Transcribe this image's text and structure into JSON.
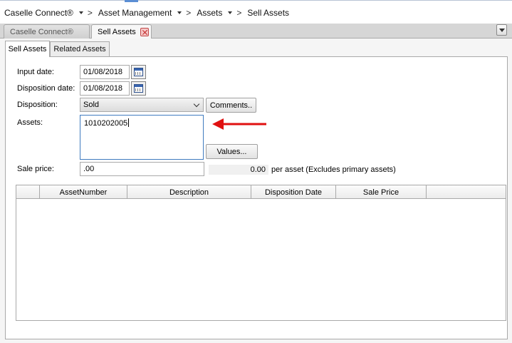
{
  "breadcrumb": {
    "items": [
      "Caselle Connect®",
      "Asset Management",
      "Assets",
      "Sell Assets"
    ],
    "separator": ">"
  },
  "doc_tabs": [
    {
      "label": "Caselle Connect®",
      "active": false
    },
    {
      "label": "Sell Assets",
      "active": true
    }
  ],
  "sub_tabs": [
    {
      "label": "Sell Assets",
      "active": true
    },
    {
      "label": "Related Assets",
      "active": false
    }
  ],
  "form": {
    "input_date_label": "Input date:",
    "input_date_value": "01/08/2018",
    "disposition_date_label": "Disposition date:",
    "disposition_date_value": "01/08/2018",
    "disposition_label": "Disposition:",
    "disposition_value": "Sold",
    "comments_button": "Comments..",
    "assets_label": "Assets:",
    "assets_value": "1010202005",
    "values_button": "Values...",
    "sale_price_label": "Sale price:",
    "sale_price_value": ".00",
    "per_asset_value": "0.00",
    "per_asset_note": "per asset (Excludes primary assets)"
  },
  "grid": {
    "columns": [
      "AssetNumber",
      "Description",
      "Disposition Date",
      "Sale Price"
    ],
    "rows": []
  },
  "colors": {
    "annotation_arrow": "#e01010",
    "focus_border": "#3f7bbf"
  },
  "icons": {
    "calendar": "calendar-icon",
    "close_tab": "close-icon",
    "dropdown": "chevron-down-icon"
  }
}
